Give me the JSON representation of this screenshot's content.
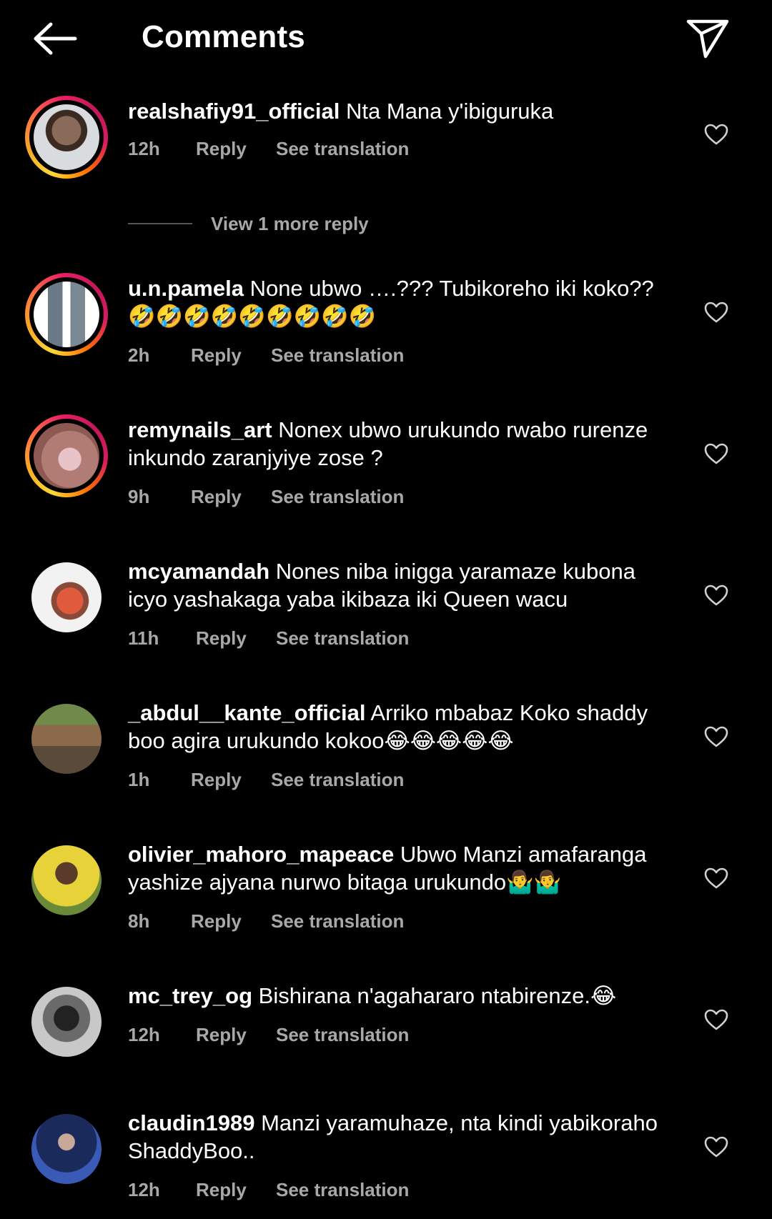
{
  "header": {
    "title": "Comments"
  },
  "actions": {
    "reply": "Reply",
    "translate": "See translation"
  },
  "view_more": "View 1 more reply",
  "comments": [
    {
      "user": "realshafiy91_official",
      "text": "Nta Mana y'ibiguruka",
      "time": "12h"
    },
    {
      "user": "u.n.pamela",
      "text": "None ubwo ….??? Tubikoreho iki koko?? 🤣🤣🤣🤣🤣🤣🤣🤣🤣",
      "time": "2h"
    },
    {
      "user": "remynails_art",
      "text": "Nonex ubwo urukundo rwabo rurenze inkundo zaranjyiye zose ?",
      "time": "9h"
    },
    {
      "user": "mcyamandah",
      "text": "Nones niba inigga yaramaze kubona icyo yashakaga yaba ikibaza iki Queen wacu",
      "time": "11h"
    },
    {
      "user": "_abdul__kante_official",
      "text": "Arriko mbabaz Koko shaddy boo agira urukundo kokoo😂😂😂😂😂",
      "time": "1h"
    },
    {
      "user": "olivier_mahoro_mapeace",
      "text": "Ubwo Manzi amafaranga yashize ajyana nurwo bitaga urukundo🤷‍♂️🤷‍♂️",
      "time": "8h"
    },
    {
      "user": "mc_trey_og",
      "text": "Bishirana n'agahararo ntabirenze.😂",
      "time": "12h"
    },
    {
      "user": "claudin1989",
      "text": "Manzi yaramuhaze, nta kindi yabikoraho ShaddyBoo..",
      "time": "12h"
    }
  ]
}
